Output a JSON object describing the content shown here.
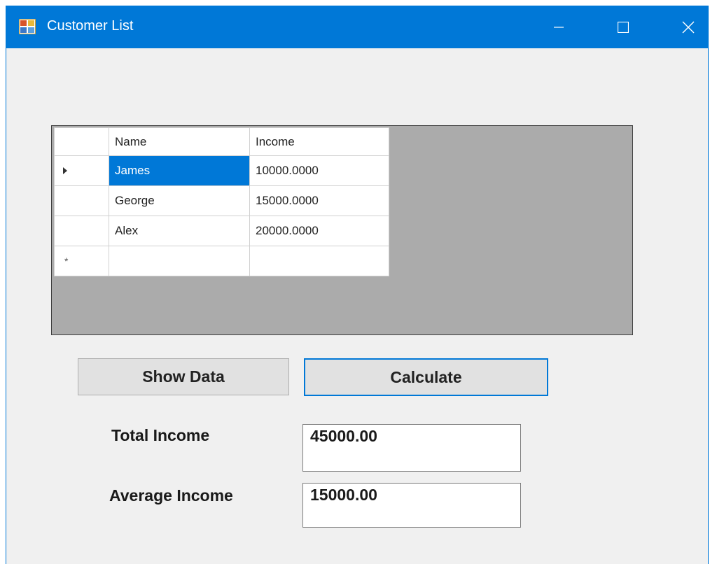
{
  "window": {
    "title": "Customer List",
    "icons": {
      "app": "form-icon",
      "minimize": "minimize-icon",
      "maximize": "maximize-icon",
      "close": "close-icon"
    },
    "accent_color": "#0078d7"
  },
  "grid": {
    "columns": [
      "Name",
      "Income"
    ],
    "rows": [
      {
        "name": "James",
        "income": "10000.0000",
        "selected": true
      },
      {
        "name": "George",
        "income": "15000.0000"
      },
      {
        "name": "Alex",
        "income": "20000.0000"
      }
    ],
    "new_row_marker": "*",
    "current_row_marker": "row-pointer-icon"
  },
  "buttons": {
    "show_data": "Show Data",
    "calculate": "Calculate"
  },
  "results": {
    "total_label": "Total Income",
    "total_value": "45000.00",
    "average_label": "Average Income",
    "average_value": "15000.00"
  }
}
